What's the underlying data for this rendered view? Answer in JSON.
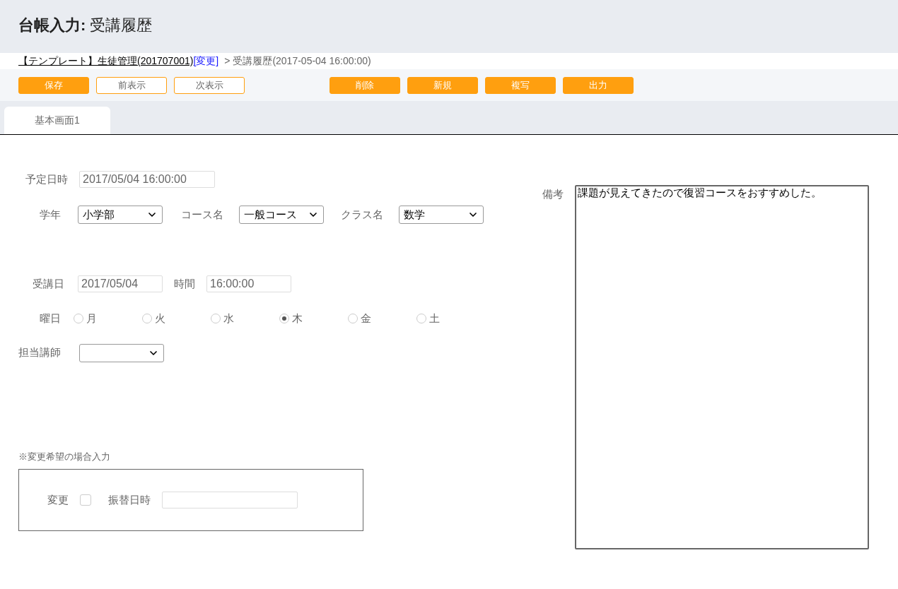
{
  "header": {
    "title_bold": "台帳入力:",
    "title": "受講履歴"
  },
  "breadcrumb": {
    "link": "【テンプレート】生徒管理(201707001)",
    "change_link": "[変更]",
    "separator": ">",
    "current": "受講履歴(2017-05-04 16:00:00)"
  },
  "toolbar": {
    "left": [
      {
        "label": "保存",
        "kind": "primary"
      },
      {
        "label": "前表示",
        "kind": "secondary"
      },
      {
        "label": "次表示",
        "kind": "secondary"
      }
    ],
    "right": [
      {
        "label": "削除",
        "kind": "primary"
      },
      {
        "label": "新規",
        "kind": "primary"
      },
      {
        "label": "複写",
        "kind": "primary"
      },
      {
        "label": "出力",
        "kind": "primary"
      }
    ]
  },
  "tabs": [
    {
      "label": "基本画面1",
      "selected": true
    }
  ],
  "form": {
    "scheduled": {
      "label": "予定日時",
      "value": "2017/05/04 16:00:00"
    },
    "grade": {
      "label": "学年",
      "value": "小学部"
    },
    "course": {
      "label": "コース名",
      "value": "一般コース"
    },
    "class": {
      "label": "クラス名",
      "value": "数学"
    },
    "date": {
      "label": "受講日",
      "value": "2017/05/04"
    },
    "time": {
      "label": "時間",
      "value": "16:00:00"
    },
    "weekday": {
      "label": "曜日",
      "options": [
        {
          "label": "月",
          "selected": false
        },
        {
          "label": "火",
          "selected": false
        },
        {
          "label": "水",
          "selected": false
        },
        {
          "label": "木",
          "selected": true
        },
        {
          "label": "金",
          "selected": false
        },
        {
          "label": "土",
          "selected": false
        }
      ]
    },
    "teacher": {
      "label": "担当講師"
    },
    "note": "※変更希望の場合入力",
    "change": {
      "label": "変更",
      "checked": false
    },
    "substitute": {
      "label": "振替日時"
    },
    "remarks": {
      "label": "備考",
      "value": "課題が見えてきたので復習コースをおすすめした。"
    }
  }
}
